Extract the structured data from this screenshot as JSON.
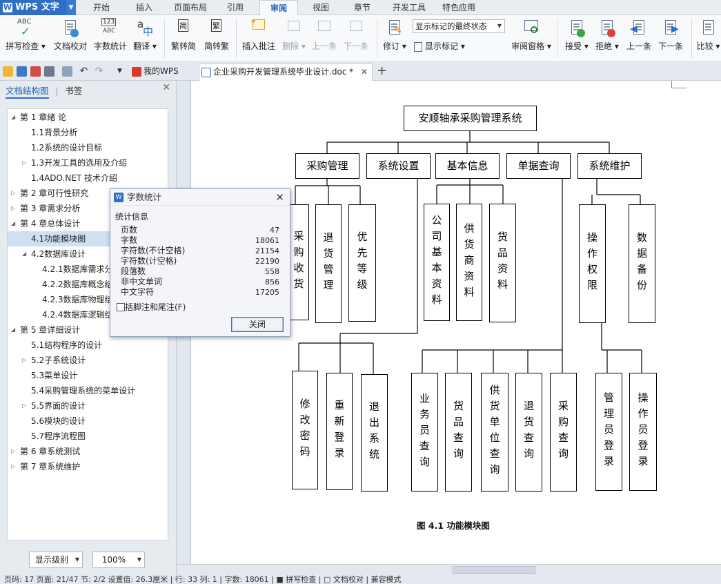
{
  "app": {
    "logo": "WPS 文字",
    "logo_mark": "W"
  },
  "ribbon_tabs": [
    "开始",
    "插入",
    "页面布局",
    "引用",
    "审阅",
    "视图",
    "章节",
    "开发工具",
    "特色应用"
  ],
  "active_ribbon_tab": "审阅",
  "ribbon": {
    "spell_check": "拼写检查",
    "doc_proofread": "文档校对",
    "word_count": "字数统计",
    "translate": "翻译",
    "trad_to_simp": "繁转简",
    "simp_to_trad": "简转繁",
    "insert_comment": "插入批注",
    "delete": "删除",
    "prev_comment": "上一条",
    "next_comment": "下一条",
    "revise": "修订",
    "markup_combo": "显示标记的最终状态",
    "show_markup": "显示标记",
    "review_pane": "审阅窗格",
    "accept": "接受",
    "reject": "拒绝",
    "prev_change": "上一条",
    "next_change": "下一条",
    "compare": "比较",
    "icon_abc": "ABC",
    "icon_123": "123",
    "icon_jian": "简",
    "icon_fan": "繁"
  },
  "doc_tabs": {
    "home": "我的WPS",
    "doc": "企业采购开发管理系统毕业设计.doc *"
  },
  "nav": {
    "tab_outline": "文档结构图",
    "tab_bookmark": "书签",
    "items": [
      {
        "text": "第 1 章绪  论",
        "level": 0,
        "tri": "◢"
      },
      {
        "text": "1.1背景分析",
        "level": 1,
        "tri": ""
      },
      {
        "text": "1.2系统的设计目标",
        "level": 1,
        "tri": ""
      },
      {
        "text": "1.3开发工具的选用及介绍",
        "level": 1,
        "tri": "▷"
      },
      {
        "text": "1.4ADO.NET 技术介绍",
        "level": 1,
        "tri": ""
      },
      {
        "text": "第 2 章可行性研究",
        "level": 0,
        "tri": "▷"
      },
      {
        "text": "第 3 章需求分析",
        "level": 0,
        "tri": "▷"
      },
      {
        "text": "第 4 章总体设计",
        "level": 0,
        "tri": "◢"
      },
      {
        "text": "4.1功能模块图",
        "level": 1,
        "tri": "",
        "selected": true
      },
      {
        "text": "4.2数据库设计",
        "level": 1,
        "tri": "◢"
      },
      {
        "text": "4.2.1数据库需求分析",
        "level": 2,
        "tri": ""
      },
      {
        "text": "4.2.2数据库概念结构设计",
        "level": 2,
        "tri": ""
      },
      {
        "text": "4.2.3数据库物理结构设计",
        "level": 2,
        "tri": ""
      },
      {
        "text": "4.2.4数据库逻辑结构设计",
        "level": 2,
        "tri": ""
      },
      {
        "text": "第 5 章详细设计",
        "level": 0,
        "tri": "◢"
      },
      {
        "text": "5.1结构程序的设计",
        "level": 1,
        "tri": ""
      },
      {
        "text": "5.2子系统设计",
        "level": 1,
        "tri": "▷"
      },
      {
        "text": "5.3菜单设计",
        "level": 1,
        "tri": ""
      },
      {
        "text": "5.4采购管理系统的菜单设计",
        "level": 1,
        "tri": ""
      },
      {
        "text": "5.5界面的设计",
        "level": 1,
        "tri": "▷"
      },
      {
        "text": "5.6模块的设计",
        "level": 1,
        "tri": ""
      },
      {
        "text": "5.7程序流程图",
        "level": 1,
        "tri": ""
      },
      {
        "text": "第 6 章系统测试",
        "level": 0,
        "tri": "▷"
      },
      {
        "text": "第 7 章系统维护",
        "level": 0,
        "tri": "▷"
      }
    ],
    "level_combo": "显示级别",
    "zoom_combo": "100%"
  },
  "word_count_dialog": {
    "title": "字数统计",
    "section": "统计信息",
    "rows": [
      {
        "label": "页数",
        "value": "47"
      },
      {
        "label": "字数",
        "value": "18061"
      },
      {
        "label": "字符数(不计空格)",
        "value": "21154"
      },
      {
        "label": "字符数(计空格)",
        "value": "22190"
      },
      {
        "label": "段落数",
        "value": "558"
      },
      {
        "label": "非中文单词",
        "value": "856"
      },
      {
        "label": "中文字符",
        "value": "17205"
      }
    ],
    "include_notes": "包括脚注和尾注(F)",
    "close_button": "关闭"
  },
  "diagram": {
    "root": "安顺轴承采购管理系统",
    "top": [
      "采购管理",
      "系统设置",
      "基本信息",
      "单据查询",
      "系统维护"
    ],
    "level2": [
      "采购收货",
      "退货管理",
      "优先等级",
      "公司基本资料",
      "供货商资料",
      "货品资料",
      "操作权限",
      "数据备份"
    ],
    "level3": [
      "修改密码",
      "重新登录",
      "退出系统",
      "业务员查询",
      "货品查询",
      "供货单位查询",
      "退货查询",
      "采购查询",
      "管理员登录",
      "操作员登录"
    ],
    "caption": "图 4.1 功能模块图"
  },
  "status_bar": "页码: 17   页面: 21/47   节: 2/2   设置值: 26.3厘米 | 行: 33   列: 1 | 字数: 18061 | ■ 拼写检查 | □ 文档校对 |   兼容模式"
}
